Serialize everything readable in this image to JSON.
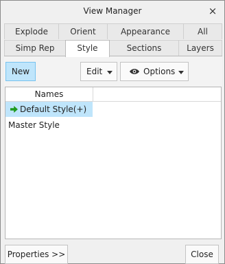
{
  "window": {
    "title": "View Manager",
    "close_glyph": "×"
  },
  "tabs": {
    "row_back": [
      "Explode",
      "Orient",
      "Appearance",
      "All"
    ],
    "row_front": [
      "Simp Rep",
      "Style",
      "Sections",
      "Layers"
    ],
    "active": "Style"
  },
  "toolbar": {
    "new_label": "New",
    "edit_label": "Edit",
    "options_label": "Options",
    "options_icon": "eye-icon"
  },
  "list": {
    "column_header": "Names",
    "rows": [
      {
        "label": "Default Style(+)",
        "active": true,
        "icon": "green-arrow-icon"
      },
      {
        "label": "Master Style",
        "active": false
      }
    ]
  },
  "footer": {
    "properties_label": "Properties >>",
    "close_label": "Close"
  },
  "colors": {
    "selection": "#bfe5fb",
    "accent_border": "#77c3ef",
    "arrow_green": "#1f9a1f"
  }
}
